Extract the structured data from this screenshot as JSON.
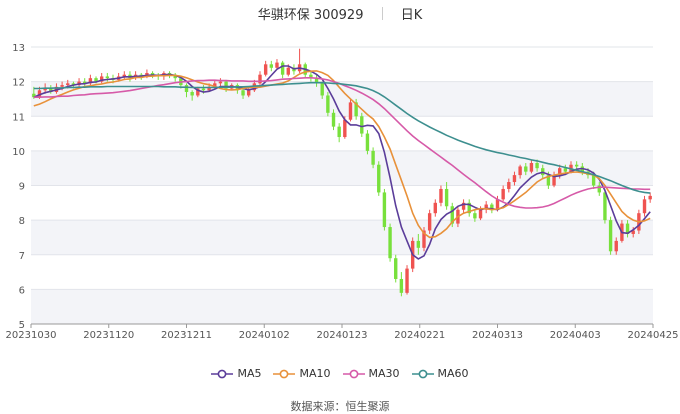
{
  "header": {
    "name": "华骐环保 300929",
    "period": "日K"
  },
  "source": "数据来源：恒生聚源",
  "chart_data": {
    "type": "candlestick",
    "ylim": [
      5,
      13
    ],
    "y_ticks": [
      "5",
      "6",
      "7",
      "8",
      "9",
      "10",
      "11",
      "12",
      "13"
    ],
    "x_tick_labels": [
      "20231030",
      "20231120",
      "20231211",
      "20240102",
      "20240123",
      "20240221",
      "20240313",
      "20240403",
      "20240425"
    ],
    "colors": {
      "up": "#ef5350",
      "down": "#78e03c",
      "MA5": "#5b3d9a",
      "MA10": "#e8913a",
      "MA30": "#d65aa8",
      "MA60": "#3d8f8f"
    },
    "candles": [
      [
        11.65,
        11.55,
        11.85,
        11.5
      ],
      [
        11.55,
        11.75,
        11.85,
        11.5
      ],
      [
        11.75,
        11.8,
        11.95,
        11.65
      ],
      [
        11.8,
        11.7,
        11.9,
        11.65
      ],
      [
        11.7,
        11.85,
        11.95,
        11.65
      ],
      [
        11.85,
        11.9,
        12.0,
        11.75
      ],
      [
        11.9,
        11.95,
        12.05,
        11.8
      ],
      [
        11.95,
        11.9,
        12.0,
        11.8
      ],
      [
        11.9,
        12.0,
        12.1,
        11.85
      ],
      [
        12.0,
        11.95,
        12.1,
        11.85
      ],
      [
        11.95,
        12.1,
        12.2,
        11.9
      ],
      [
        12.1,
        12.0,
        12.15,
        11.95
      ],
      [
        12.0,
        12.15,
        12.25,
        11.95
      ],
      [
        12.15,
        12.1,
        12.25,
        12.0
      ],
      [
        12.1,
        12.05,
        12.2,
        11.95
      ],
      [
        12.05,
        12.15,
        12.25,
        12.0
      ],
      [
        12.15,
        12.2,
        12.3,
        12.05
      ],
      [
        12.2,
        12.1,
        12.3,
        12.0
      ],
      [
        12.1,
        12.2,
        12.3,
        12.05
      ],
      [
        12.2,
        12.15,
        12.25,
        12.05
      ],
      [
        12.15,
        12.25,
        12.35,
        12.1
      ],
      [
        12.25,
        12.2,
        12.3,
        12.1
      ],
      [
        12.2,
        12.15,
        12.25,
        12.05
      ],
      [
        12.15,
        12.25,
        12.3,
        12.05
      ],
      [
        12.25,
        12.2,
        12.3,
        12.1
      ],
      [
        12.2,
        12.1,
        12.25,
        12.0
      ],
      [
        12.1,
        11.9,
        12.15,
        11.8
      ],
      [
        11.9,
        11.7,
        11.95,
        11.55
      ],
      [
        11.7,
        11.6,
        11.75,
        11.45
      ],
      [
        11.6,
        11.8,
        11.85,
        11.55
      ],
      [
        11.8,
        11.75,
        11.9,
        11.65
      ],
      [
        11.75,
        11.85,
        11.95,
        11.7
      ],
      [
        11.85,
        11.95,
        12.05,
        11.8
      ],
      [
        11.95,
        12.0,
        12.1,
        11.85
      ],
      [
        12.0,
        11.8,
        12.05,
        11.7
      ],
      [
        11.8,
        11.9,
        11.95,
        11.75
      ],
      [
        11.9,
        11.75,
        11.95,
        11.65
      ],
      [
        11.75,
        11.6,
        11.8,
        11.5
      ],
      [
        11.6,
        11.75,
        11.85,
        11.55
      ],
      [
        11.75,
        11.95,
        12.05,
        11.7
      ],
      [
        11.95,
        12.2,
        12.3,
        11.9
      ],
      [
        12.2,
        12.5,
        12.6,
        12.15
      ],
      [
        12.5,
        12.4,
        12.6,
        12.3
      ],
      [
        12.4,
        12.55,
        12.65,
        12.35
      ],
      [
        12.55,
        12.2,
        12.6,
        12.1
      ],
      [
        12.2,
        12.4,
        12.5,
        12.15
      ],
      [
        12.4,
        12.3,
        12.5,
        12.2
      ],
      [
        12.3,
        12.5,
        12.95,
        12.25
      ],
      [
        12.5,
        12.2,
        12.55,
        12.1
      ],
      [
        12.2,
        12.1,
        12.3,
        12.0
      ],
      [
        12.1,
        11.95,
        12.2,
        11.85
      ],
      [
        11.95,
        11.6,
        12.0,
        11.5
      ],
      [
        11.6,
        11.1,
        11.7,
        11.0
      ],
      [
        11.1,
        10.7,
        11.2,
        10.6
      ],
      [
        10.7,
        10.4,
        10.8,
        10.25
      ],
      [
        10.4,
        10.9,
        11.0,
        10.35
      ],
      [
        10.9,
        11.4,
        11.5,
        10.85
      ],
      [
        11.4,
        11.0,
        11.5,
        10.9
      ],
      [
        11.0,
        10.5,
        11.1,
        10.4
      ],
      [
        10.5,
        10.0,
        10.6,
        9.9
      ],
      [
        10.0,
        9.6,
        10.1,
        9.5
      ],
      [
        9.6,
        8.8,
        9.7,
        8.7
      ],
      [
        8.8,
        7.8,
        8.9,
        7.7
      ],
      [
        7.8,
        6.9,
        7.9,
        6.8
      ],
      [
        6.9,
        6.3,
        7.0,
        6.2
      ],
      [
        6.3,
        5.9,
        6.5,
        5.8
      ],
      [
        5.9,
        6.6,
        6.7,
        5.85
      ],
      [
        6.6,
        7.4,
        7.5,
        6.5
      ],
      [
        7.4,
        7.2,
        7.6,
        7.0
      ],
      [
        7.2,
        7.7,
        7.8,
        7.1
      ],
      [
        7.7,
        8.2,
        8.3,
        7.6
      ],
      [
        8.2,
        8.5,
        8.6,
        8.1
      ],
      [
        8.5,
        8.9,
        9.0,
        8.4
      ],
      [
        8.9,
        8.4,
        9.1,
        8.3
      ],
      [
        8.4,
        7.9,
        8.5,
        7.8
      ],
      [
        7.9,
        8.3,
        8.4,
        7.8
      ],
      [
        8.3,
        8.5,
        8.6,
        8.2
      ],
      [
        8.5,
        8.2,
        8.6,
        8.1
      ],
      [
        8.2,
        8.05,
        8.3,
        7.95
      ],
      [
        8.05,
        8.3,
        8.4,
        8.0
      ],
      [
        8.3,
        8.45,
        8.55,
        8.2
      ],
      [
        8.45,
        8.3,
        8.5,
        8.2
      ],
      [
        8.3,
        8.6,
        8.7,
        8.25
      ],
      [
        8.6,
        8.9,
        9.0,
        8.55
      ],
      [
        8.9,
        9.1,
        9.2,
        8.8
      ],
      [
        9.1,
        9.3,
        9.4,
        9.0
      ],
      [
        9.3,
        9.55,
        9.6,
        9.2
      ],
      [
        9.55,
        9.4,
        9.65,
        9.3
      ],
      [
        9.4,
        9.65,
        9.75,
        9.35
      ],
      [
        9.65,
        9.5,
        9.75,
        9.4
      ],
      [
        9.5,
        9.3,
        9.6,
        9.2
      ],
      [
        9.3,
        9.0,
        9.4,
        8.9
      ],
      [
        9.0,
        9.3,
        9.4,
        8.95
      ],
      [
        9.3,
        9.5,
        9.6,
        9.2
      ],
      [
        9.5,
        9.4,
        9.6,
        9.3
      ],
      [
        9.4,
        9.6,
        9.7,
        9.35
      ],
      [
        9.6,
        9.55,
        9.7,
        9.45
      ],
      [
        9.55,
        9.4,
        9.65,
        9.3
      ],
      [
        9.4,
        9.3,
        9.5,
        9.2
      ],
      [
        9.3,
        9.0,
        9.4,
        8.9
      ],
      [
        9.0,
        8.8,
        9.1,
        8.7
      ],
      [
        8.8,
        8.0,
        8.9,
        7.9
      ],
      [
        8.0,
        7.1,
        8.1,
        7.0
      ],
      [
        7.1,
        7.4,
        7.5,
        7.0
      ],
      [
        7.4,
        7.9,
        8.0,
        7.35
      ],
      [
        7.9,
        7.6,
        8.0,
        7.5
      ],
      [
        7.6,
        7.7,
        7.8,
        7.5
      ],
      [
        7.7,
        8.2,
        8.3,
        7.6
      ],
      [
        8.2,
        8.6,
        8.7,
        8.1
      ],
      [
        8.6,
        8.7,
        8.8,
        8.5
      ]
    ],
    "series": [
      {
        "name": "MA5",
        "values": [
          11.55,
          11.62,
          11.68,
          11.72,
          11.76,
          11.8,
          11.86,
          11.9,
          11.93,
          11.94,
          11.98,
          11.99,
          12.04,
          12.06,
          12.08,
          12.1,
          12.14,
          12.14,
          12.15,
          12.16,
          12.18,
          12.19,
          12.18,
          12.2,
          12.21,
          12.18,
          12.12,
          12.01,
          11.86,
          11.75,
          11.7,
          11.72,
          11.78,
          11.86,
          11.86,
          11.86,
          11.84,
          11.8,
          11.76,
          11.8,
          11.85,
          12.0,
          12.18,
          12.36,
          12.45,
          12.45,
          12.37,
          12.39,
          12.36,
          12.3,
          12.21,
          12.07,
          11.8,
          11.5,
          11.15,
          10.9,
          10.75,
          10.75,
          10.7,
          10.74,
          10.72,
          10.5,
          9.96,
          9.22,
          8.42,
          7.8,
          7.4,
          7.0,
          6.88,
          6.97,
          7.3,
          7.75,
          8.02,
          8.17,
          8.26,
          8.4,
          8.46,
          8.45,
          8.37,
          8.3,
          8.34,
          8.33,
          8.3,
          8.38,
          8.51,
          8.71,
          8.93,
          9.09,
          9.24,
          9.34,
          9.38,
          9.32,
          9.26,
          9.28,
          9.32,
          9.4,
          9.47,
          9.49,
          9.45,
          9.36,
          9.18,
          8.86,
          8.42,
          7.98,
          7.64,
          7.62,
          7.72,
          7.85,
          8.04,
          8.24
        ]
      },
      {
        "name": "MA10",
        "values": [
          11.3,
          11.35,
          11.42,
          11.5,
          11.57,
          11.63,
          11.7,
          11.76,
          11.81,
          11.86,
          11.88,
          11.91,
          11.93,
          11.97,
          11.99,
          12.02,
          12.06,
          12.08,
          12.12,
          12.12,
          12.15,
          12.16,
          12.17,
          12.17,
          12.18,
          12.18,
          12.16,
          12.11,
          12.05,
          11.99,
          11.94,
          11.91,
          11.86,
          11.8,
          11.77,
          11.76,
          11.77,
          11.8,
          11.83,
          11.84,
          11.84,
          11.87,
          11.9,
          11.93,
          11.96,
          12.02,
          12.12,
          12.22,
          12.28,
          12.3,
          12.31,
          12.26,
          12.18,
          12.03,
          11.84,
          11.66,
          11.5,
          11.35,
          11.2,
          11.05,
          10.92,
          10.7,
          10.4,
          10.05,
          9.6,
          9.15,
          8.7,
          8.2,
          7.85,
          7.62,
          7.5,
          7.52,
          7.62,
          7.75,
          7.95,
          8.1,
          8.2,
          8.25,
          8.3,
          8.33,
          8.33,
          8.3,
          8.32,
          8.36,
          8.45,
          8.56,
          8.68,
          8.8,
          8.95,
          9.1,
          9.2,
          9.26,
          9.3,
          9.33,
          9.36,
          9.38,
          9.39,
          9.37,
          9.34,
          9.3,
          9.2,
          9.0,
          8.75,
          8.5,
          8.25,
          8.1,
          8.0,
          7.95,
          7.98,
          8.05
        ]
      },
      {
        "name": "MA30",
        "values": [
          11.55,
          11.55,
          11.56,
          11.56,
          11.57,
          11.58,
          11.58,
          11.6,
          11.61,
          11.62,
          11.64,
          11.65,
          11.66,
          11.67,
          11.68,
          11.7,
          11.72,
          11.74,
          11.77,
          11.8,
          11.83,
          11.86,
          11.89,
          11.91,
          11.94,
          11.97,
          11.99,
          12.0,
          12.02,
          12.03,
          12.03,
          12.04,
          12.04,
          12.03,
          12.03,
          12.02,
          12.02,
          12.02,
          12.01,
          12.01,
          12.01,
          12.02,
          12.03,
          12.05,
          12.07,
          12.08,
          12.09,
          12.1,
          12.11,
          12.11,
          12.1,
          12.08,
          12.05,
          12.0,
          11.95,
          11.88,
          11.82,
          11.75,
          11.67,
          11.58,
          11.48,
          11.36,
          11.22,
          11.06,
          10.9,
          10.74,
          10.58,
          10.43,
          10.3,
          10.18,
          10.06,
          9.94,
          9.82,
          9.7,
          9.58,
          9.45,
          9.32,
          9.2,
          9.08,
          8.95,
          8.82,
          8.7,
          8.6,
          8.52,
          8.45,
          8.4,
          8.37,
          8.35,
          8.35,
          8.36,
          8.38,
          8.42,
          8.48,
          8.56,
          8.64,
          8.72,
          8.79,
          8.85,
          8.9,
          8.93,
          8.95,
          8.95,
          8.94,
          8.93,
          8.92,
          8.91,
          8.9,
          8.9,
          8.89,
          8.89
        ]
      },
      {
        "name": "MA60",
        "values": [
          11.8,
          11.8,
          11.81,
          11.81,
          11.82,
          11.82,
          11.83,
          11.83,
          11.84,
          11.84,
          11.85,
          11.85,
          11.85,
          11.86,
          11.86,
          11.86,
          11.86,
          11.86,
          11.86,
          11.86,
          11.86,
          11.86,
          11.86,
          11.85,
          11.85,
          11.85,
          11.84,
          11.84,
          11.83,
          11.83,
          11.83,
          11.83,
          11.83,
          11.84,
          11.84,
          11.84,
          11.85,
          11.85,
          11.86,
          11.87,
          11.88,
          11.89,
          11.9,
          11.91,
          11.92,
          11.93,
          11.94,
          11.95,
          11.96,
          11.97,
          11.97,
          11.97,
          11.96,
          11.95,
          11.94,
          11.92,
          11.9,
          11.88,
          11.84,
          11.8,
          11.74,
          11.66,
          11.56,
          11.44,
          11.32,
          11.2,
          11.08,
          10.97,
          10.87,
          10.78,
          10.69,
          10.61,
          10.53,
          10.45,
          10.38,
          10.31,
          10.25,
          10.19,
          10.13,
          10.08,
          10.03,
          9.99,
          9.95,
          9.92,
          9.88,
          9.85,
          9.81,
          9.78,
          9.74,
          9.71,
          9.67,
          9.63,
          9.6,
          9.56,
          9.52,
          9.48,
          9.44,
          9.4,
          9.36,
          9.31,
          9.26,
          9.2,
          9.14,
          9.07,
          9.0,
          8.94,
          8.88,
          8.83,
          8.8,
          8.78
        ]
      }
    ],
    "grid": true,
    "legend_position": "bottom-center"
  }
}
